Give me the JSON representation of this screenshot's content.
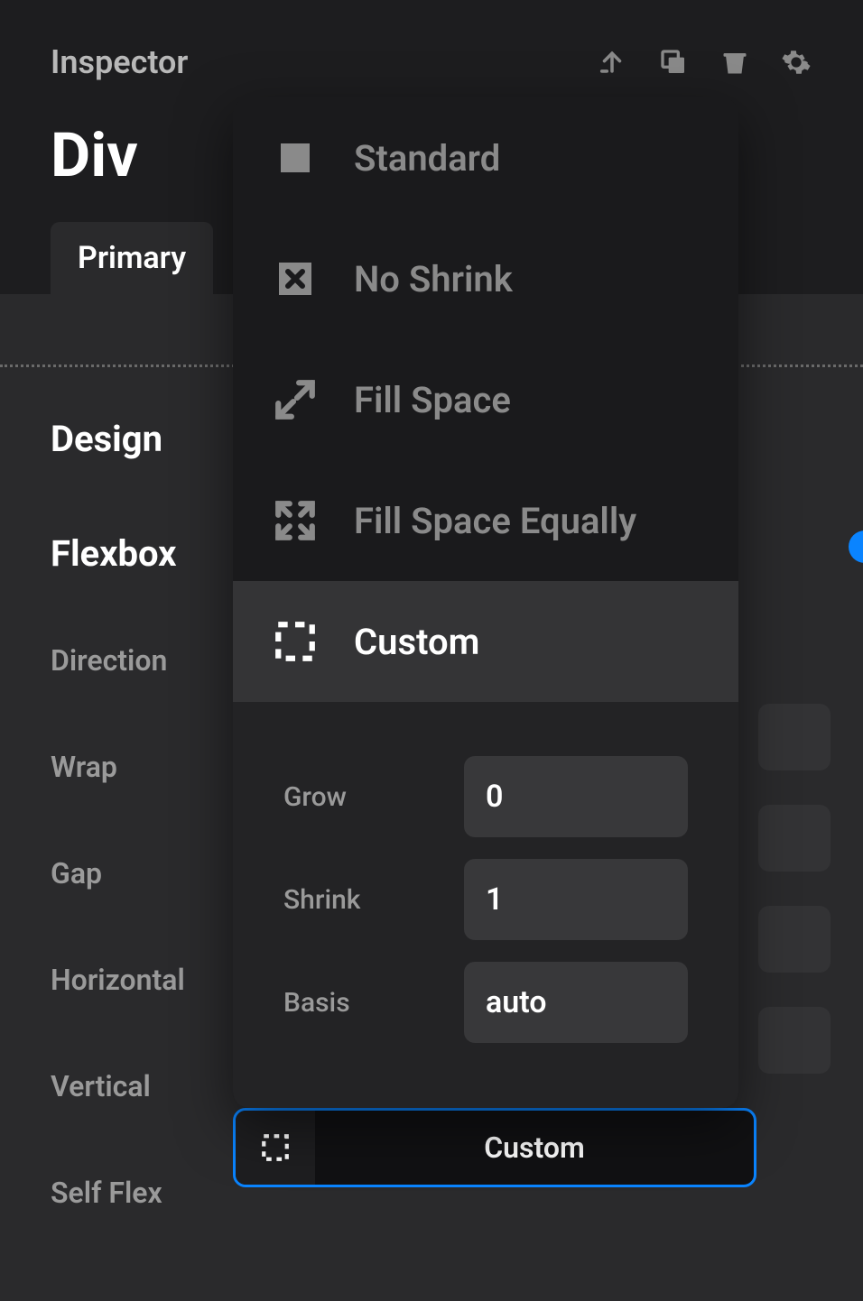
{
  "header": {
    "title": "Inspector",
    "element": "Div"
  },
  "tabs": {
    "primary": "Primary"
  },
  "sections": {
    "design": "Design",
    "flexbox": "Flexbox"
  },
  "props": {
    "direction": "Direction",
    "wrap": "Wrap",
    "gap": "Gap",
    "horizontal": "Horizontal",
    "vertical": "Vertical",
    "selfflex": "Self Flex"
  },
  "popover": {
    "standard": "Standard",
    "noshrink": "No Shrink",
    "fillspace": "Fill Space",
    "fillspaceeq": "Fill Space Equally",
    "custom": "Custom"
  },
  "custom": {
    "grow_label": "Grow",
    "grow_value": "0",
    "shrink_label": "Shrink",
    "shrink_value": "1",
    "basis_label": "Basis",
    "basis_value": "auto"
  },
  "selfflex_control": {
    "label": "Custom"
  }
}
